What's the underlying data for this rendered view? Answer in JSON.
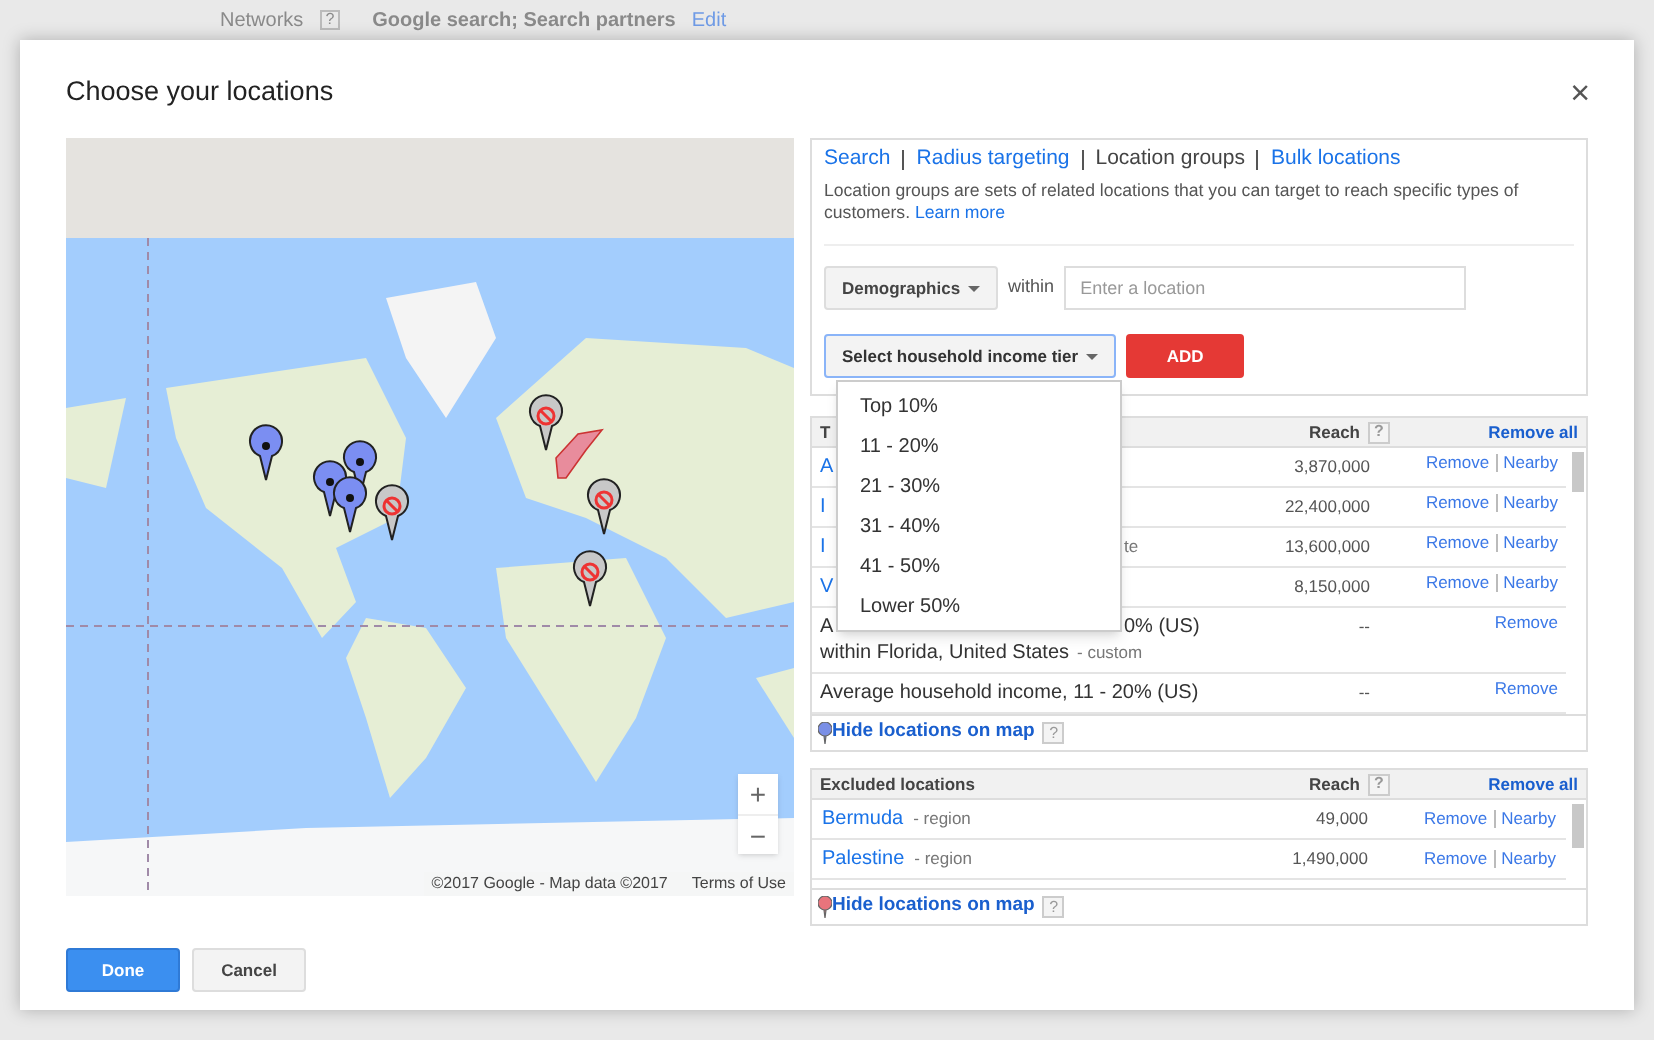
{
  "background": {
    "label": "Networks",
    "help": "?",
    "value": "Google search; Search partners",
    "link": "Edit"
  },
  "dialog": {
    "title": "Choose your locations",
    "close": "×"
  },
  "map": {
    "zoom_in": "+",
    "zoom_out": "−",
    "attribution": "©2017 Google - Map data ©2017",
    "terms": "Terms of Use"
  },
  "tabs": [
    {
      "label": "Search",
      "selected": false
    },
    {
      "label": "Radius targeting",
      "selected": false
    },
    {
      "label": "Location groups",
      "selected": true
    },
    {
      "label": "Bulk locations",
      "selected": false
    }
  ],
  "description": {
    "text": "Location groups are sets of related locations that you can target to reach specific types of customers.",
    "link": "Learn more"
  },
  "group_type": {
    "label": "Demographics",
    "within": "within",
    "placeholder": "Enter a location"
  },
  "income_select": {
    "label": "Select household income tier",
    "expanded": true,
    "add": "ADD",
    "options": [
      "Top 10%",
      "11 - 20%",
      "21 - 30%",
      "31 - 40%",
      "41 - 50%",
      "Lower 50%"
    ]
  },
  "targeted": {
    "header": "T",
    "reach": "Reach",
    "help": "?",
    "remove_all": "Remove all",
    "rows": [
      {
        "name": "A",
        "name_end": "",
        "line2": "",
        "suffix": "",
        "reach": "3,870,000",
        "actions": [
          "Remove",
          "Nearby"
        ]
      },
      {
        "name": "I",
        "name_end": "",
        "line2": "",
        "suffix": "",
        "reach": "22,400,000",
        "actions": [
          "Remove",
          "Nearby"
        ]
      },
      {
        "name": "I",
        "name_end": "te",
        "line2": "",
        "suffix": "",
        "reach": "13,600,000",
        "actions": [
          "Remove",
          "Nearby"
        ]
      },
      {
        "name": "V",
        "name_end": "",
        "line2": "",
        "suffix": "",
        "reach": "8,150,000",
        "actions": [
          "Remove",
          "Nearby"
        ]
      },
      {
        "name": "A",
        "name_end": "0% (US)",
        "line2": "within Florida, United States",
        "suffix": "- custom",
        "reach": "--",
        "actions": [
          "Remove"
        ]
      },
      {
        "name": "Average household income, 11 - 20% (US)",
        "name_end": "",
        "line2": "",
        "suffix": "",
        "reach": "--",
        "actions": [
          "Remove"
        ]
      }
    ],
    "footer": "Hide locations on map",
    "footer_help": "?"
  },
  "excluded": {
    "header": "Excluded locations",
    "reach": "Reach",
    "help": "?",
    "remove_all": "Remove all",
    "rows": [
      {
        "name": "Bermuda",
        "suffix": "- region",
        "reach": "49,000",
        "actions": [
          "Remove",
          "Nearby"
        ]
      },
      {
        "name": "Palestine",
        "suffix": "- region",
        "reach": "1,490,000",
        "actions": [
          "Remove",
          "Nearby"
        ]
      }
    ],
    "footer": "Hide locations on map",
    "footer_help": "?"
  },
  "buttons": [
    {
      "label": "Done",
      "kind": "primary"
    },
    {
      "label": "Cancel",
      "kind": "secondary"
    }
  ]
}
